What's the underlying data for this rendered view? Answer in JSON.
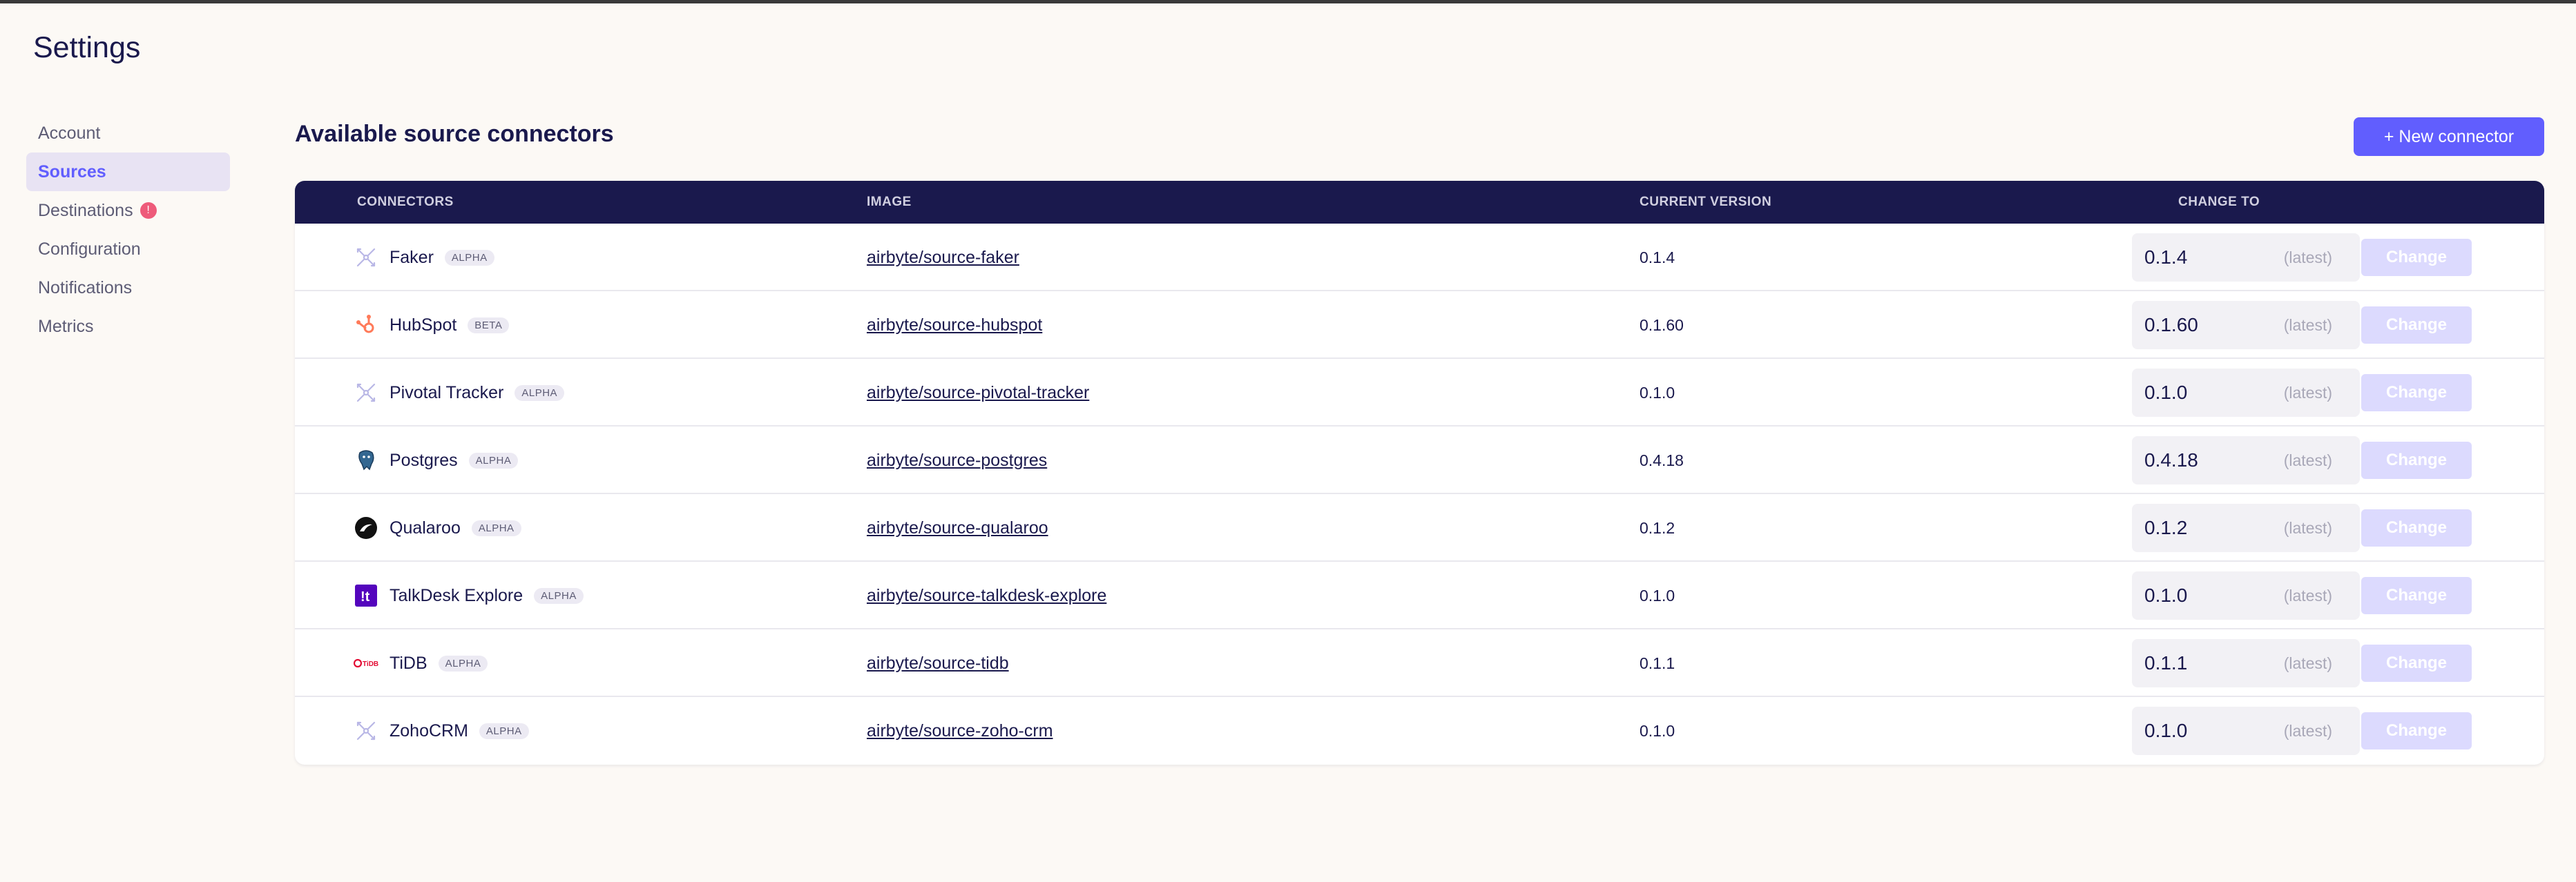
{
  "page": {
    "title": "Settings"
  },
  "sidebar": {
    "items": [
      {
        "label": "Account"
      },
      {
        "label": "Sources"
      },
      {
        "label": "Destinations",
        "badge": "!"
      },
      {
        "label": "Configuration"
      },
      {
        "label": "Notifications"
      },
      {
        "label": "Metrics"
      }
    ]
  },
  "main": {
    "title": "Available source connectors",
    "new_button": "+ New connector",
    "columns": [
      "CONNECTORS",
      "IMAGE",
      "CURRENT VERSION",
      "CHANGE TO"
    ],
    "latest_label": "(latest)",
    "change_label": "Change",
    "rows": [
      {
        "name": "Faker",
        "tag": "ALPHA",
        "image": "airbyte/source-faker",
        "version": "0.1.4",
        "icon": "default-connector-icon"
      },
      {
        "name": "HubSpot",
        "tag": "BETA",
        "image": "airbyte/source-hubspot",
        "version": "0.1.60",
        "icon": "hubspot-icon"
      },
      {
        "name": "Pivotal Tracker",
        "tag": "ALPHA",
        "image": "airbyte/source-pivotal-tracker",
        "version": "0.1.0",
        "icon": "default-connector-icon"
      },
      {
        "name": "Postgres",
        "tag": "ALPHA",
        "image": "airbyte/source-postgres",
        "version": "0.4.18",
        "icon": "postgres-icon"
      },
      {
        "name": "Qualaroo",
        "tag": "ALPHA",
        "image": "airbyte/source-qualaroo",
        "version": "0.1.2",
        "icon": "qualaroo-icon"
      },
      {
        "name": "TalkDesk Explore",
        "tag": "ALPHA",
        "image": "airbyte/source-talkdesk-explore",
        "version": "0.1.0",
        "icon": "talkdesk-icon"
      },
      {
        "name": "TiDB",
        "tag": "ALPHA",
        "image": "airbyte/source-tidb",
        "version": "0.1.1",
        "icon": "tidb-icon"
      },
      {
        "name": "ZohoCRM",
        "tag": "ALPHA",
        "image": "airbyte/source-zoho-crm",
        "version": "0.1.0",
        "icon": "default-connector-icon"
      }
    ]
  },
  "colors": {
    "accent": "#615efe",
    "header_bg": "#1a194d",
    "badge": "#ee5b7a",
    "page_bg": "#fcf9f5"
  }
}
